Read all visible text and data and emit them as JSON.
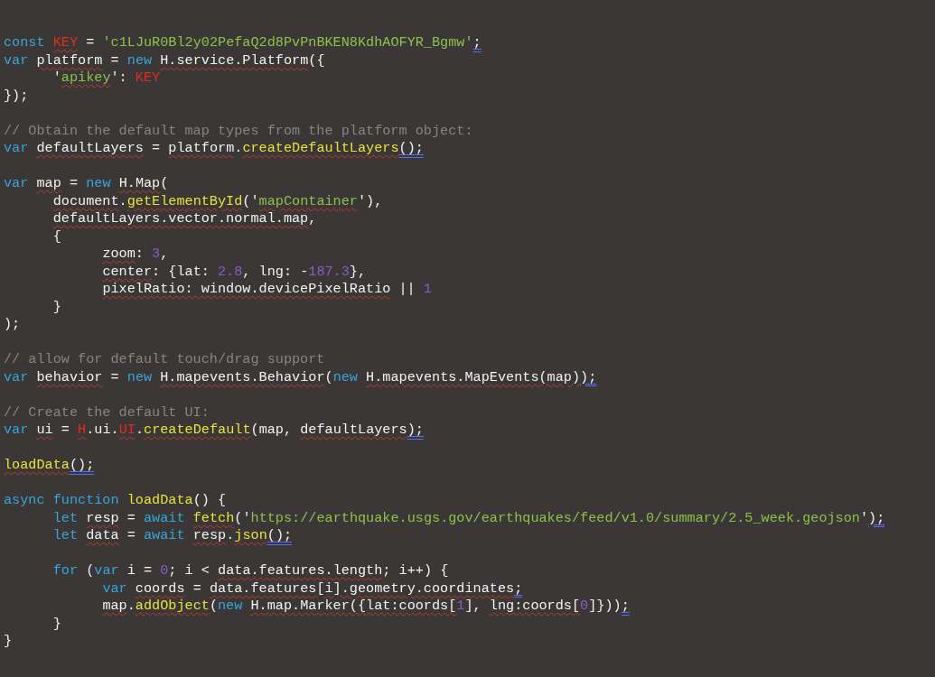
{
  "editor": {
    "lines": [
      {
        "kind": "code",
        "tokens": [
          {
            "text": "const ",
            "kind": "keyword",
            "misspelled": false,
            "warning": false
          },
          {
            "text": "KEY",
            "kind": "constant",
            "misspelled": true,
            "warning": false
          },
          {
            "text": " = ",
            "kind": "plain",
            "misspelled": false,
            "warning": false
          },
          {
            "text": "'c1LJuR0Bl2y02PefaQ2d8PvPnBKEN8KdhAOFYR_Bgmw'",
            "kind": "string",
            "misspelled": false,
            "warning": false
          },
          {
            "text": ";",
            "kind": "plain",
            "misspelled": false,
            "warning": true
          }
        ]
      },
      {
        "kind": "code",
        "tokens": [
          {
            "text": "var ",
            "kind": "keyword",
            "misspelled": false,
            "warning": false
          },
          {
            "text": "platform",
            "kind": "plain",
            "misspelled": true,
            "warning": false
          },
          {
            "text": " = ",
            "kind": "plain",
            "misspelled": false,
            "warning": false
          },
          {
            "text": "new ",
            "kind": "keyword",
            "misspelled": false,
            "warning": false
          },
          {
            "text": "H.service.Platform",
            "kind": "plain",
            "misspelled": true,
            "warning": false
          },
          {
            "text": "({",
            "kind": "plain",
            "misspelled": false,
            "warning": false
          }
        ]
      },
      {
        "kind": "code",
        "tokens": [
          {
            "text": "\t'",
            "kind": "plain",
            "misspelled": false,
            "warning": false
          },
          {
            "text": "apikey",
            "kind": "string",
            "misspelled": true,
            "warning": false
          },
          {
            "text": "': ",
            "kind": "plain",
            "misspelled": false,
            "warning": false
          },
          {
            "text": "KEY",
            "kind": "constant",
            "misspelled": false,
            "warning": false
          }
        ]
      },
      {
        "kind": "code",
        "tokens": [
          {
            "text": "});",
            "kind": "plain",
            "misspelled": false,
            "warning": false
          }
        ]
      },
      {
        "kind": "blank"
      },
      {
        "kind": "code",
        "tokens": [
          {
            "text": "// Obtain the default map types from the platform object:",
            "kind": "comment",
            "misspelled": false,
            "warning": false
          }
        ]
      },
      {
        "kind": "code",
        "tokens": [
          {
            "text": "var ",
            "kind": "keyword",
            "misspelled": false,
            "warning": false
          },
          {
            "text": "defaultLayers",
            "kind": "plain",
            "misspelled": true,
            "warning": false
          },
          {
            "text": " = ",
            "kind": "plain",
            "misspelled": false,
            "warning": false
          },
          {
            "text": "platform",
            "kind": "plain",
            "misspelled": true,
            "warning": false
          },
          {
            "text": ".",
            "kind": "plain",
            "misspelled": false,
            "warning": false
          },
          {
            "text": "createDefaultLayers",
            "kind": "function",
            "misspelled": true,
            "warning": false
          },
          {
            "text": "();",
            "kind": "plain",
            "misspelled": false,
            "warning": true
          }
        ]
      },
      {
        "kind": "blank"
      },
      {
        "kind": "code",
        "tokens": [
          {
            "text": "var ",
            "kind": "keyword",
            "misspelled": false,
            "warning": false
          },
          {
            "text": "map",
            "kind": "plain",
            "misspelled": true,
            "warning": false
          },
          {
            "text": " = ",
            "kind": "plain",
            "misspelled": false,
            "warning": false
          },
          {
            "text": "new ",
            "kind": "keyword",
            "misspelled": false,
            "warning": false
          },
          {
            "text": "H.Map",
            "kind": "plain",
            "misspelled": true,
            "warning": false
          },
          {
            "text": "(",
            "kind": "plain",
            "misspelled": false,
            "warning": false
          }
        ]
      },
      {
        "kind": "code",
        "tokens": [
          {
            "text": "\tdocument",
            "kind": "plain",
            "misspelled": true,
            "warning": false
          },
          {
            "text": ".",
            "kind": "plain",
            "misspelled": false,
            "warning": false
          },
          {
            "text": "getElementById",
            "kind": "function",
            "misspelled": true,
            "warning": false
          },
          {
            "text": "('",
            "kind": "plain",
            "misspelled": false,
            "warning": false
          },
          {
            "text": "mapContainer",
            "kind": "string",
            "misspelled": true,
            "warning": false
          },
          {
            "text": "'),",
            "kind": "plain",
            "misspelled": false,
            "warning": false
          }
        ]
      },
      {
        "kind": "code",
        "tokens": [
          {
            "text": "\tdefaultLayers.vector.normal.map",
            "kind": "plain",
            "misspelled": true,
            "warning": false
          },
          {
            "text": ",",
            "kind": "plain",
            "misspelled": false,
            "warning": false
          }
        ]
      },
      {
        "kind": "code",
        "tokens": [
          {
            "text": "\t{",
            "kind": "plain",
            "misspelled": false,
            "warning": false
          }
        ]
      },
      {
        "kind": "code",
        "tokens": [
          {
            "text": "\t\tzoom",
            "kind": "plain",
            "misspelled": true,
            "warning": false
          },
          {
            "text": ": ",
            "kind": "plain",
            "misspelled": false,
            "warning": false
          },
          {
            "text": "3",
            "kind": "number",
            "misspelled": false,
            "warning": false
          },
          {
            "text": ",",
            "kind": "plain",
            "misspelled": false,
            "warning": false
          }
        ]
      },
      {
        "kind": "code",
        "tokens": [
          {
            "text": "\t\tcenter",
            "kind": "plain",
            "misspelled": true,
            "warning": false
          },
          {
            "text": ": {lat: ",
            "kind": "plain",
            "misspelled": false,
            "warning": false
          },
          {
            "text": "2.8",
            "kind": "number",
            "misspelled": false,
            "warning": false
          },
          {
            "text": ", lng: -",
            "kind": "plain",
            "misspelled": false,
            "warning": false
          },
          {
            "text": "187.3",
            "kind": "number",
            "misspelled": false,
            "warning": false
          },
          {
            "text": "},",
            "kind": "plain",
            "misspelled": false,
            "warning": false
          }
        ]
      },
      {
        "kind": "code",
        "tokens": [
          {
            "text": "\t\tpixelRatio: window.devicePixelRatio",
            "kind": "plain",
            "misspelled": true,
            "warning": false
          },
          {
            "text": " || ",
            "kind": "plain",
            "misspelled": false,
            "warning": false
          },
          {
            "text": "1",
            "kind": "number",
            "misspelled": false,
            "warning": false
          }
        ]
      },
      {
        "kind": "code",
        "tokens": [
          {
            "text": "\t}",
            "kind": "plain",
            "misspelled": false,
            "warning": false
          }
        ]
      },
      {
        "kind": "code",
        "tokens": [
          {
            "text": ");",
            "kind": "plain",
            "misspelled": false,
            "warning": false
          }
        ]
      },
      {
        "kind": "blank"
      },
      {
        "kind": "code",
        "tokens": [
          {
            "text": "// allow for default touch/drag support",
            "kind": "comment",
            "misspelled": false,
            "warning": false
          }
        ]
      },
      {
        "kind": "code",
        "tokens": [
          {
            "text": "var ",
            "kind": "keyword",
            "misspelled": false,
            "warning": false
          },
          {
            "text": "behavior",
            "kind": "plain",
            "misspelled": true,
            "warning": false
          },
          {
            "text": " = ",
            "kind": "plain",
            "misspelled": false,
            "warning": false
          },
          {
            "text": "new ",
            "kind": "keyword",
            "misspelled": false,
            "warning": false
          },
          {
            "text": "H.mapevents.Behavior",
            "kind": "plain",
            "misspelled": true,
            "warning": false
          },
          {
            "text": "(",
            "kind": "plain",
            "misspelled": false,
            "warning": false
          },
          {
            "text": "new ",
            "kind": "keyword",
            "misspelled": false,
            "warning": false
          },
          {
            "text": "H.mapevents.MapEvents(map)",
            "kind": "plain",
            "misspelled": true,
            "warning": false
          },
          {
            "text": ");",
            "kind": "plain",
            "misspelled": false,
            "warning": true
          }
        ]
      },
      {
        "kind": "blank"
      },
      {
        "kind": "code",
        "tokens": [
          {
            "text": "// Create the default UI:",
            "kind": "comment",
            "misspelled": false,
            "warning": false
          }
        ]
      },
      {
        "kind": "code",
        "tokens": [
          {
            "text": "var ",
            "kind": "keyword",
            "misspelled": false,
            "warning": false
          },
          {
            "text": "ui",
            "kind": "plain",
            "misspelled": true,
            "warning": false
          },
          {
            "text": " = ",
            "kind": "plain",
            "misspelled": false,
            "warning": false
          },
          {
            "text": "H",
            "kind": "constant",
            "misspelled": true,
            "warning": false
          },
          {
            "text": ".ui.",
            "kind": "plain",
            "misspelled": false,
            "warning": false
          },
          {
            "text": "UI",
            "kind": "constant",
            "misspelled": true,
            "warning": false
          },
          {
            "text": ".",
            "kind": "plain",
            "misspelled": false,
            "warning": false
          },
          {
            "text": "createDefault",
            "kind": "function",
            "misspelled": true,
            "warning": false
          },
          {
            "text": "(map, ",
            "kind": "plain",
            "misspelled": false,
            "warning": false
          },
          {
            "text": "defaultLayers",
            "kind": "plain",
            "misspelled": true,
            "warning": false
          },
          {
            "text": ");",
            "kind": "plain",
            "misspelled": false,
            "warning": true
          }
        ]
      },
      {
        "kind": "blank"
      },
      {
        "kind": "code",
        "tokens": [
          {
            "text": "loadData",
            "kind": "function",
            "misspelled": true,
            "warning": false
          },
          {
            "text": "();",
            "kind": "plain",
            "misspelled": false,
            "warning": true
          }
        ]
      },
      {
        "kind": "blank"
      },
      {
        "kind": "code",
        "tokens": [
          {
            "text": "async function ",
            "kind": "keyword",
            "misspelled": false,
            "warning": false
          },
          {
            "text": "loadData",
            "kind": "function",
            "misspelled": false,
            "warning": false
          },
          {
            "text": "() {",
            "kind": "plain",
            "misspelled": false,
            "warning": false
          }
        ]
      },
      {
        "kind": "code",
        "tokens": [
          {
            "text": "\tlet ",
            "kind": "keyword",
            "misspelled": false,
            "warning": false
          },
          {
            "text": "resp",
            "kind": "plain",
            "misspelled": true,
            "warning": false
          },
          {
            "text": " = ",
            "kind": "plain",
            "misspelled": false,
            "warning": false
          },
          {
            "text": "await ",
            "kind": "keyword",
            "misspelled": false,
            "warning": false
          },
          {
            "text": "fetch",
            "kind": "function",
            "misspelled": true,
            "warning": false
          },
          {
            "text": "('",
            "kind": "plain",
            "misspelled": false,
            "warning": false
          },
          {
            "text": "https://earthquake.usgs.gov/earthquakes/feed/v1.0/summary/2.5_week.geojson",
            "kind": "string",
            "misspelled": false,
            "warning": false
          },
          {
            "text": "'",
            "kind": "plain",
            "misspelled": false,
            "warning": false
          },
          {
            "text": ");",
            "kind": "plain",
            "misspelled": false,
            "warning": true
          }
        ]
      },
      {
        "kind": "code",
        "tokens": [
          {
            "text": "\tlet ",
            "kind": "keyword",
            "misspelled": false,
            "warning": false
          },
          {
            "text": "data",
            "kind": "plain",
            "misspelled": true,
            "warning": false
          },
          {
            "text": " = ",
            "kind": "plain",
            "misspelled": false,
            "warning": false
          },
          {
            "text": "await ",
            "kind": "keyword",
            "misspelled": false,
            "warning": false
          },
          {
            "text": "resp",
            "kind": "plain",
            "misspelled": true,
            "warning": false
          },
          {
            "text": ".",
            "kind": "plain",
            "misspelled": false,
            "warning": false
          },
          {
            "text": "json",
            "kind": "function",
            "misspelled": true,
            "warning": false
          },
          {
            "text": "();",
            "kind": "plain",
            "misspelled": false,
            "warning": true
          }
        ]
      },
      {
        "kind": "blank"
      },
      {
        "kind": "code",
        "tokens": [
          {
            "text": "\tfor",
            "kind": "keyword",
            "misspelled": false,
            "warning": false
          },
          {
            "text": " (",
            "kind": "plain",
            "misspelled": false,
            "warning": false
          },
          {
            "text": "var",
            "kind": "keyword",
            "misspelled": false,
            "warning": false
          },
          {
            "text": " i = ",
            "kind": "plain",
            "misspelled": false,
            "warning": false
          },
          {
            "text": "0",
            "kind": "number",
            "misspelled": false,
            "warning": false
          },
          {
            "text": "; i < ",
            "kind": "plain",
            "misspelled": false,
            "warning": false
          },
          {
            "text": "data.features.length",
            "kind": "plain",
            "misspelled": true,
            "warning": false
          },
          {
            "text": "; i++) {",
            "kind": "plain",
            "misspelled": false,
            "warning": false
          }
        ]
      },
      {
        "kind": "code",
        "tokens": [
          {
            "text": "\t\tvar ",
            "kind": "keyword",
            "misspelled": false,
            "warning": false
          },
          {
            "text": "coords",
            "kind": "plain",
            "misspelled": true,
            "warning": false
          },
          {
            "text": " = ",
            "kind": "plain",
            "misspelled": false,
            "warning": false
          },
          {
            "text": "data.features[i].geometry.coordinates",
            "kind": "plain",
            "misspelled": true,
            "warning": false
          },
          {
            "text": ";",
            "kind": "plain",
            "misspelled": false,
            "warning": true
          }
        ]
      },
      {
        "kind": "code",
        "tokens": [
          {
            "text": "\t\tmap",
            "kind": "plain",
            "misspelled": true,
            "warning": false
          },
          {
            "text": ".",
            "kind": "plain",
            "misspelled": false,
            "warning": false
          },
          {
            "text": "addObject",
            "kind": "function",
            "misspelled": true,
            "warning": false
          },
          {
            "text": "(",
            "kind": "plain",
            "misspelled": false,
            "warning": false
          },
          {
            "text": "new ",
            "kind": "keyword",
            "misspelled": false,
            "warning": false
          },
          {
            "text": "H.map.Marker({lat:coords[",
            "kind": "plain",
            "misspelled": true,
            "warning": false
          },
          {
            "text": "1",
            "kind": "number",
            "misspelled": false,
            "warning": false
          },
          {
            "text": "], ",
            "kind": "plain",
            "misspelled": false,
            "warning": false
          },
          {
            "text": "lng:coords[",
            "kind": "plain",
            "misspelled": true,
            "warning": false
          },
          {
            "text": "0",
            "kind": "number",
            "misspelled": false,
            "warning": false
          },
          {
            "text": "]}))",
            "kind": "plain",
            "misspelled": false,
            "warning": false
          },
          {
            "text": ";",
            "kind": "plain",
            "misspelled": false,
            "warning": true
          }
        ]
      },
      {
        "kind": "code",
        "tokens": [
          {
            "text": "\t}",
            "kind": "plain",
            "misspelled": false,
            "warning": false
          }
        ]
      },
      {
        "kind": "code",
        "tokens": [
          {
            "text": "}",
            "kind": "plain",
            "misspelled": false,
            "warning": false
          }
        ]
      }
    ]
  }
}
